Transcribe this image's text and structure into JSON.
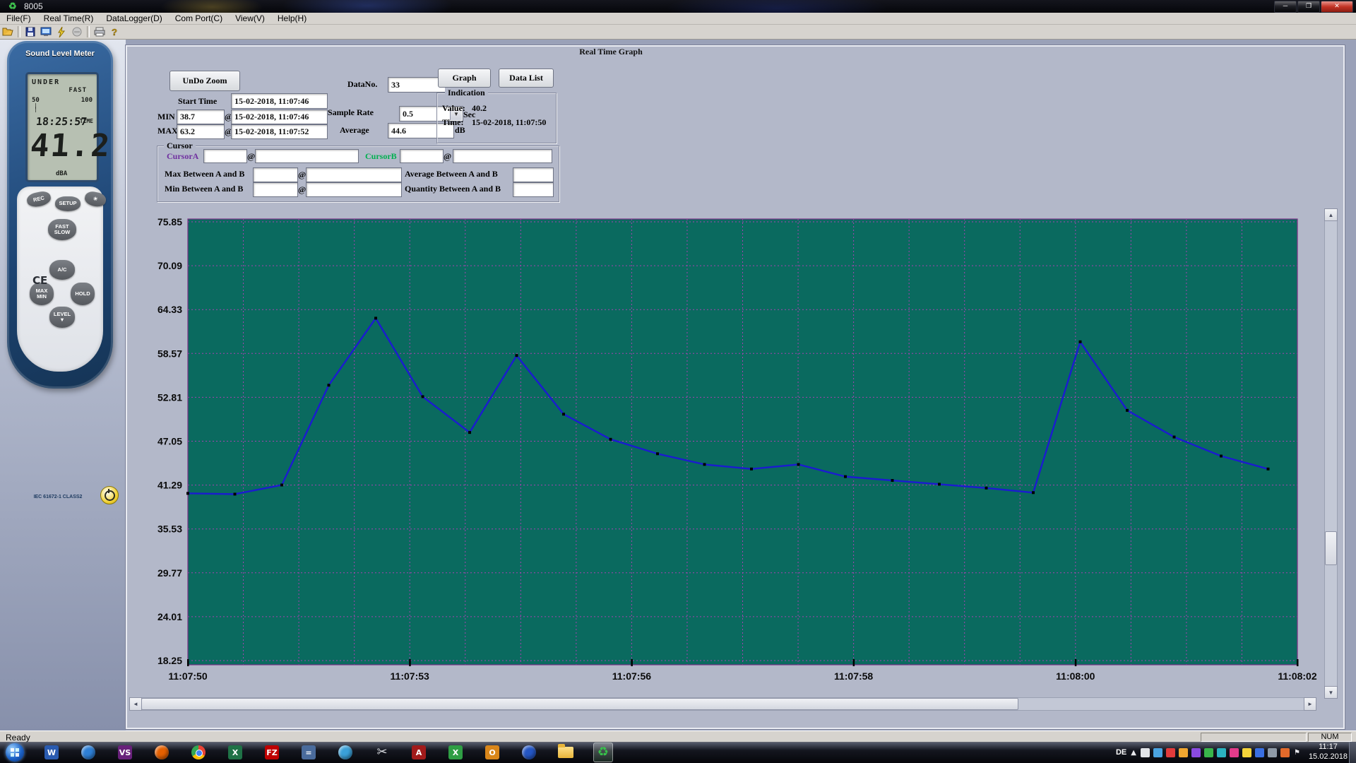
{
  "win": {
    "title": "8005"
  },
  "menu": {
    "items": [
      {
        "label": "File(F)"
      },
      {
        "label": "Real Time(R)"
      },
      {
        "label": "DataLogger(D)"
      },
      {
        "label": "Com Port(C)"
      },
      {
        "label": "View(V)"
      },
      {
        "label": "Help(H)"
      }
    ]
  },
  "toolbar": {
    "icons": [
      "open-folder-icon",
      "save-icon",
      "realtime-monitor-icon",
      "connect-lightning-icon",
      "stop-icon",
      "print-icon",
      "help-icon"
    ]
  },
  "device": {
    "title": "Sound Level Meter",
    "lcd": {
      "under": "UNDER",
      "fast": "FAST",
      "scale_low": "50",
      "scale_high": "100",
      "time": "18:25:57",
      "time_label": "TIME",
      "value": "41.2",
      "unit": "dBA"
    },
    "buttons": {
      "rec": "REC",
      "setup": "SETUP",
      "fast_slow": "FAST\nSLOW",
      "ac": "A/C",
      "max_min": "MAX\nMIN",
      "hold": "HOLD",
      "level": "LEVEL\n▼"
    },
    "ce": "CE",
    "cert": "IEC 61672-1 CLASS2"
  },
  "panel": {
    "title": "Real Time Graph",
    "undo_zoom": "UnDo Zoom",
    "start_time_label": "Start Time",
    "start_time": "15-02-2018, 11:07:46",
    "datano_label": "DataNo.",
    "datano": "33",
    "graph_btn": "Graph",
    "datalist_btn": "Data List",
    "min_label": "MIN",
    "min_value": "38.7",
    "min_time": "15-02-2018, 11:07:46",
    "max_label": "MAX",
    "max_value": "63.2",
    "max_time": "15-02-2018, 11:07:52",
    "at": "@",
    "sample_rate_label": "Sample Rate",
    "sample_rate_value": "0.5",
    "sec_label": "Sec",
    "average_label": "Average",
    "average_value": "44.6",
    "db_label": "dB",
    "indication": {
      "title": "Indication",
      "value_label": "Value:",
      "value": "40.2",
      "time_label": "Time:",
      "time": "15-02-2018, 11:07:50"
    },
    "cursor": {
      "title": "Cursor",
      "a_label": "CursorA",
      "b_label": "CursorB",
      "max_between_label": "Max Between A and B",
      "min_between_label": "Min Between A and B",
      "avg_between_label": "Average Between A and B",
      "qty_between_label": "Quantity Between A and B",
      "a1": "",
      "a2": "",
      "b1": "",
      "b2": "",
      "max1": "",
      "max2": "",
      "min1": "",
      "min2": "",
      "avg": "",
      "qty": ""
    }
  },
  "chart_data": {
    "type": "line",
    "title": "Real Time Graph",
    "y_tick_labels": [
      "75.85",
      "70.09",
      "64.33",
      "58.57",
      "52.81",
      "47.05",
      "41.29",
      "35.53",
      "29.77",
      "24.01",
      "18.25"
    ],
    "x_tick_labels": [
      "11:07:50",
      "11:07:53",
      "11:07:56",
      "11:07:58",
      "11:08:00",
      "11:08:02"
    ],
    "ylim": [
      18.25,
      75.85
    ],
    "sample_interval_s": 0.5,
    "first_visible_time": "11:07:50",
    "values": [
      40.2,
      40.1,
      41.3,
      54.4,
      63.2,
      52.9,
      48.2,
      58.3,
      50.6,
      47.3,
      45.4,
      44.0,
      43.4,
      44.0,
      42.4,
      41.9,
      41.4,
      40.9,
      40.3,
      60.1,
      51.1,
      47.6,
      45.1,
      43.4
    ],
    "grid": true,
    "bg_color": "#0a6a5f",
    "grid_color": "#c03cc0",
    "line_color": "#1b1bd0",
    "point_color": "#000000"
  },
  "status": {
    "ready": "Ready",
    "num": "NUM"
  },
  "taskbar": {
    "lang": "DE",
    "clock": {
      "time": "11:17",
      "date": "15.02.2018"
    },
    "icons": [
      {
        "name": "start-button",
        "kind": "orb"
      },
      {
        "name": "taskbar-word-icon",
        "label": "W",
        "color": "#2a5bb0"
      },
      {
        "name": "taskbar-media-player-icon",
        "kind": "circle",
        "color": "#2e7fd6"
      },
      {
        "name": "taskbar-visual-studio-icon",
        "label": "VS",
        "color": "#68217a"
      },
      {
        "name": "taskbar-firefox-icon",
        "kind": "circle",
        "color": "#e66000"
      },
      {
        "name": "taskbar-chrome-icon",
        "kind": "chrome"
      },
      {
        "name": "taskbar-excel-icon",
        "label": "X",
        "color": "#1f7246"
      },
      {
        "name": "taskbar-filezilla-icon",
        "label": "FZ",
        "color": "#bf0000"
      },
      {
        "name": "taskbar-calculator-icon",
        "label": "=",
        "color": "#4a6b9c"
      },
      {
        "name": "taskbar-movie-maker-icon",
        "kind": "circle",
        "color": "#3aa0d8"
      },
      {
        "name": "taskbar-snipping-tool-icon",
        "kind": "glyph",
        "glyph": "✂",
        "color": "#d8dadf"
      },
      {
        "name": "taskbar-adobe-reader-icon",
        "label": "A",
        "color": "#a21b1b"
      },
      {
        "name": "taskbar-xshell-icon",
        "label": "X",
        "color": "#2f9e44"
      },
      {
        "name": "taskbar-outlook-icon",
        "label": "O",
        "color": "#d9861a"
      },
      {
        "name": "taskbar-messenger-icon",
        "kind": "circle",
        "color": "#2456c4"
      },
      {
        "name": "taskbar-folder-icon",
        "kind": "folder"
      },
      {
        "name": "taskbar-app-8005-icon",
        "kind": "glyph",
        "glyph": "♻",
        "color": "#37c24a",
        "active": true
      }
    ],
    "tray_icons": [
      "#e2e4e8",
      "#4aa3e0",
      "#e23b3b",
      "#f0a630",
      "#8a4ae0",
      "#39b54a",
      "#2bb3c0",
      "#e23b8a",
      "#f5d33a",
      "#3a6fe2",
      "#8f9aa8",
      "#e26a2b"
    ]
  }
}
